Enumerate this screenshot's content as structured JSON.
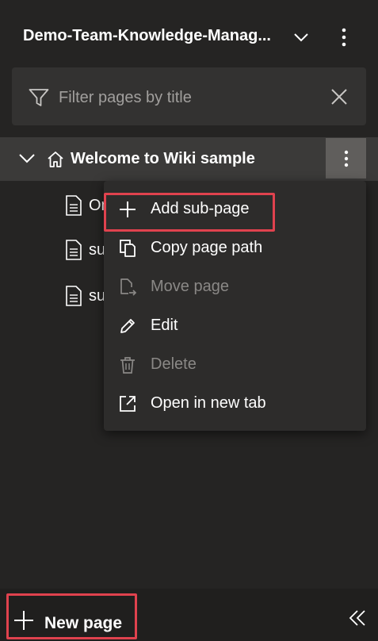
{
  "header": {
    "wiki_title": "Demo-Team-Knowledge-Manag...",
    "icons": {
      "dropdown": "chevron-down-icon",
      "more": "more-vertical-icon"
    }
  },
  "filter": {
    "placeholder": "Filter pages by title",
    "value": "",
    "icons": {
      "filter": "filter-icon",
      "clear": "close-icon"
    }
  },
  "tree": {
    "root": {
      "label": "Welcome to Wiki sample",
      "expanded": true,
      "icon": "home-icon"
    },
    "children": [
      {
        "label": "On",
        "icon": "document-icon"
      },
      {
        "label": "su",
        "icon": "document-icon"
      },
      {
        "label": "su",
        "icon": "document-icon"
      }
    ]
  },
  "context_menu": {
    "items": [
      {
        "label": "Add sub-page",
        "icon": "plus-icon",
        "enabled": true,
        "highlighted": true
      },
      {
        "label": "Copy page path",
        "icon": "copy-icon",
        "enabled": true
      },
      {
        "label": "Move page",
        "icon": "move-icon",
        "enabled": false
      },
      {
        "label": "Edit",
        "icon": "pencil-icon",
        "enabled": true
      },
      {
        "label": "Delete",
        "icon": "trash-icon",
        "enabled": false
      },
      {
        "label": "Open in new tab",
        "icon": "open-new-tab-icon",
        "enabled": true
      }
    ]
  },
  "footer": {
    "new_page_label": "New page",
    "new_page_highlighted": true,
    "icons": {
      "add": "plus-icon",
      "collapse": "double-chevron-left-icon"
    }
  },
  "colors": {
    "background": "#252423",
    "selected_row": "#3b3a39",
    "menu_background": "#2d2c2b",
    "highlight": "#e0424e",
    "disabled_text": "#8a8886",
    "placeholder_text": "#a19f9d"
  }
}
